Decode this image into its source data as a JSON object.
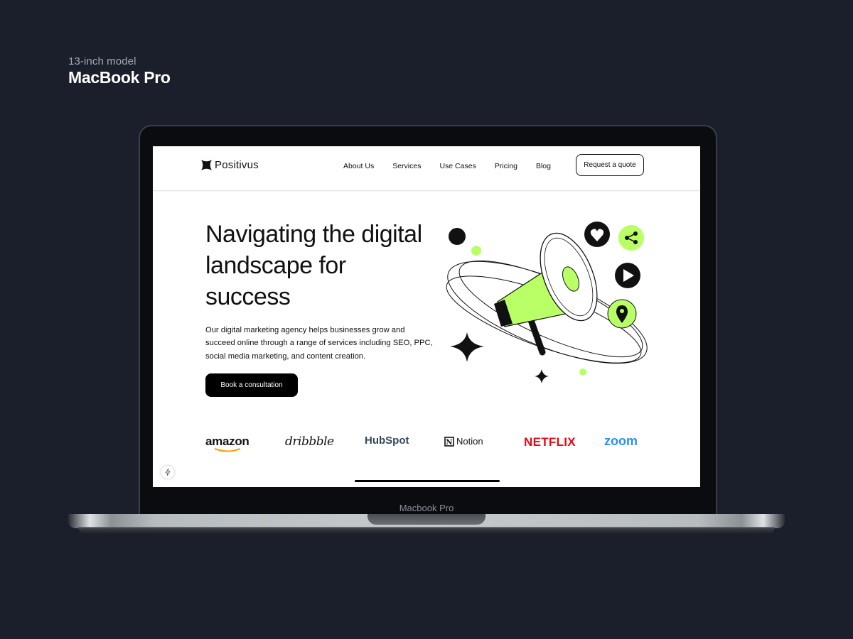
{
  "frame": {
    "model_subtitle": "13-inch model",
    "model_title": "MacBook Pro",
    "lid_label": "Macbook Pro"
  },
  "site": {
    "brand": "Positivus",
    "nav": [
      "About Us",
      "Services",
      "Use Cases",
      "Pricing",
      "Blog"
    ],
    "cta_nav": "Request a quote",
    "hero_title": "Navigating the digital landscape for success",
    "hero_desc": "Our digital marketing agency helps businesses grow and succeed online through a range of services including SEO, PPC, social media marketing, and content creation.",
    "hero_cta": "Book a consultation",
    "brands": {
      "amazon": "amazon",
      "dribbble": "dribbble",
      "hubspot": "HubSpot",
      "notion": "Notion",
      "netflix": "NETFLIX",
      "zoom": "zoom"
    }
  },
  "colors": {
    "accent": "#b9ff66",
    "dark": "#191a23",
    "background": "#1b1f2b"
  }
}
